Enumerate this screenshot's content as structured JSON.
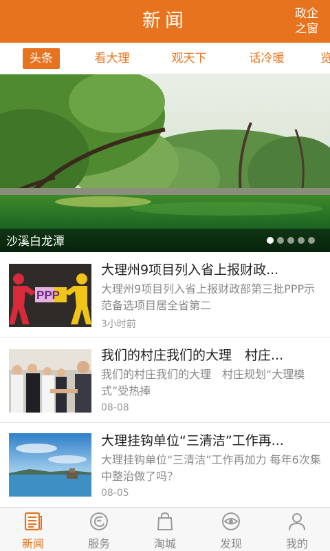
{
  "header": {
    "title": "新闻",
    "link_line1": "政企",
    "link_line2": "之窗"
  },
  "tabs": [
    {
      "label": "头条"
    },
    {
      "label": "看大理"
    },
    {
      "label": "观天下"
    },
    {
      "label": "话冷暖"
    },
    {
      "label": "览"
    }
  ],
  "banner": {
    "caption": "沙溪白龙潭",
    "slide_count": 5,
    "active_slide": 1
  },
  "news": [
    {
      "title": "大理州9项目列入省上报财政...",
      "summary": "大理州9项目列入省上报财政部第三批PPP示范备选项目居全省第二",
      "time": "3小时前",
      "thumb_text": "PPP"
    },
    {
      "title": "我们的村庄我们的大理　村庄...",
      "summary": "我们的村庄我们的大理　村庄规划“大理模式”受热捧",
      "time": "08-08"
    },
    {
      "title": "大理挂钩单位“三清洁”工作再...",
      "summary": "大理挂钩单位“三清洁”工作再加力 每年6次集中整治做了吗？",
      "time": "08-05"
    }
  ],
  "bottom_nav": [
    {
      "label": "新闻",
      "icon": "news-icon"
    },
    {
      "label": "服务",
      "icon": "service-icon"
    },
    {
      "label": "淘城",
      "icon": "shopping-bag-icon"
    },
    {
      "label": "发现",
      "icon": "eye-icon"
    },
    {
      "label": "我的",
      "icon": "user-icon"
    }
  ],
  "colors": {
    "accent": "#e8731e",
    "inactive": "#888888"
  }
}
